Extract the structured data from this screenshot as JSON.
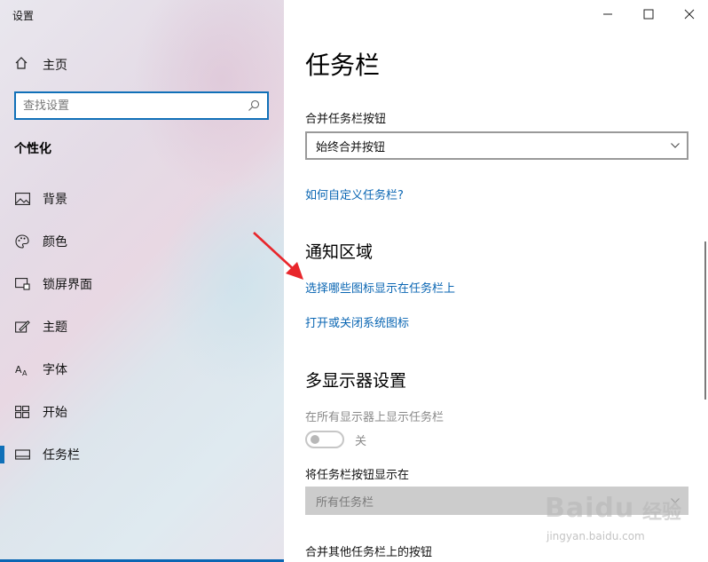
{
  "window": {
    "title": "设置"
  },
  "sidebar": {
    "home_label": "主页",
    "search_placeholder": "查找设置",
    "section_title": "个性化",
    "items": [
      {
        "label": "背景",
        "icon": "picture-icon",
        "active": false
      },
      {
        "label": "颜色",
        "icon": "palette-icon",
        "active": false
      },
      {
        "label": "锁屏界面",
        "icon": "lock-screen-icon",
        "active": false
      },
      {
        "label": "主题",
        "icon": "theme-brush-icon",
        "active": false
      },
      {
        "label": "字体",
        "icon": "font-icon",
        "active": false
      },
      {
        "label": "开始",
        "icon": "start-grid-icon",
        "active": false
      },
      {
        "label": "任务栏",
        "icon": "taskbar-icon",
        "active": true
      }
    ]
  },
  "main": {
    "title": "任务栏",
    "combine_label": "合并任务栏按钮",
    "combine_value": "始终合并按钮",
    "customize_link": "如何自定义任务栏?",
    "notification_heading": "通知区域",
    "select_icons_link": "选择哪些图标显示在任务栏上",
    "system_icons_link": "打开或关闭系统图标",
    "multi_heading": "多显示器设置",
    "show_all_label": "在所有显示器上显示任务栏",
    "toggle_state": "关",
    "show_buttons_label": "将任务栏按钮显示在",
    "show_buttons_value": "所有任务栏",
    "combine_other_label": "合并其他任务栏上的按钮"
  },
  "watermark": {
    "brand": "Baidu",
    "suffix": "经验",
    "url": "jingyan.baidu.com"
  },
  "colors": {
    "accent": "#0a66b3",
    "arrow": "#e8262b"
  }
}
